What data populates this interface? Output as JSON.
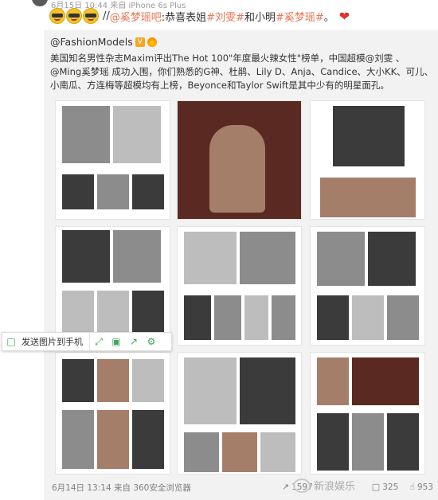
{
  "post": {
    "meta": "6月15日 10:44 来自 iPhone 6s Plus",
    "slash": "//",
    "mention": "@奚梦瑶吧",
    "text_mid": ":恭喜表姐",
    "hashtag1": "#刘雯#",
    "text_and": " 和小明",
    "hashtag2": "#奚梦瑶#",
    "text_end": " 。"
  },
  "original": {
    "author": "@FashionModels",
    "verified_mark": "V",
    "text": "美国知名男性杂志Maxim评出The Hot 100\"年度最火辣女性\"榜单，中国超模@刘雯 、@Ming奚梦瑶 成功入围，你们熟悉的G神、杜鹃、Lily D、Anja、Candice、大小KK、可儿、小南瓜、方连梅等超模均有上榜，Beyonce和Taylor Swift是其中少有的明星面孔。"
  },
  "toolbar": {
    "send_label": "发送图片到手机",
    "icons": [
      "phone-icon",
      "fullscreen-icon",
      "save-icon",
      "share-icon",
      "settings-icon"
    ]
  },
  "footer": {
    "time": "6月14日 13:14 来自 360安全浏览器",
    "reposts": "1597",
    "comments": "325",
    "likes": "953",
    "watermark": "新浪娱乐"
  }
}
